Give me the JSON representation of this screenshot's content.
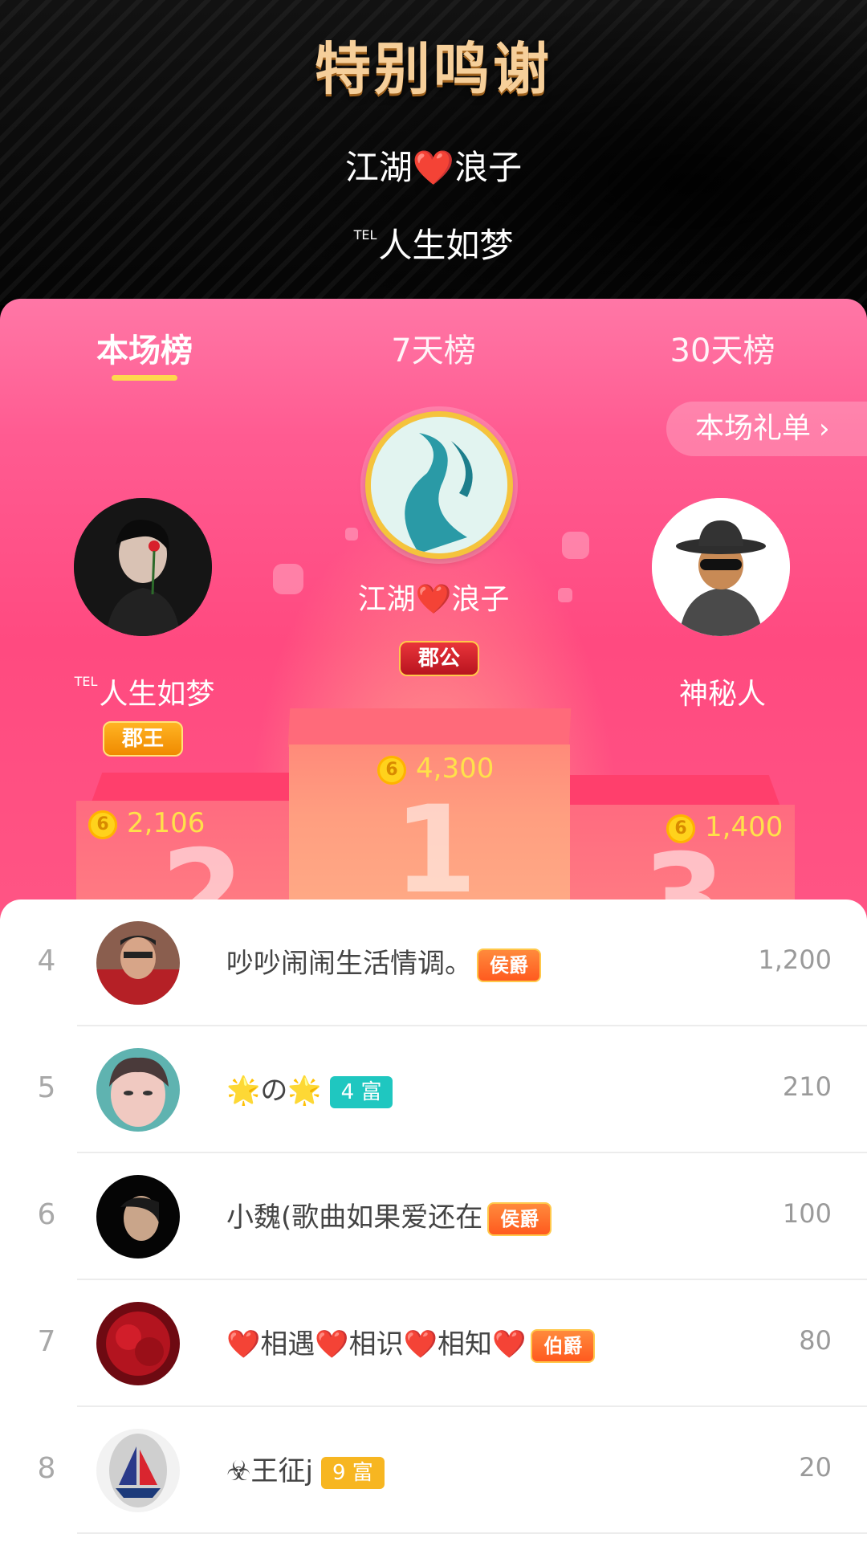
{
  "thanks": {
    "title": "特别鸣谢",
    "names": [
      {
        "prefix": "",
        "name": "江湖❤️浪子"
      },
      {
        "prefix": "TEL",
        "name": "人生如梦"
      }
    ]
  },
  "tabs": [
    {
      "label": "本场榜",
      "active": true
    },
    {
      "label": "7天榜",
      "active": false
    },
    {
      "label": "30天榜",
      "active": false
    }
  ],
  "gift_list_label": "本场礼单",
  "podium": {
    "first": {
      "rank": "1",
      "name": "江湖❤️浪子",
      "badge": "郡公",
      "score": "4,300"
    },
    "second": {
      "rank": "2",
      "prefix": "TEL",
      "name": "人生如梦",
      "badge": "郡王",
      "score": "2,106"
    },
    "third": {
      "rank": "3",
      "name": "神秘人",
      "score": "1,400"
    }
  },
  "coin_symbol": "6",
  "list": [
    {
      "rank": "4",
      "name": "吵吵闹闹生活情调。",
      "badge": "侯爵",
      "badge_type": "title",
      "score": "1,200"
    },
    {
      "rank": "5",
      "name": "🌟の🌟",
      "badge": "4 富",
      "badge_type": "rich",
      "badge_color": "#1fc7c0",
      "score": "210"
    },
    {
      "rank": "6",
      "name": "小魏(歌曲如果爱还在",
      "badge": "侯爵",
      "badge_type": "title",
      "score": "100"
    },
    {
      "rank": "7",
      "name": "❤️相遇❤️相识❤️相知❤️",
      "badge": "伯爵",
      "badge_type": "title",
      "score": "80"
    },
    {
      "rank": "8",
      "name": "☣王征j",
      "badge": "9 富",
      "badge_type": "rich",
      "badge_color": "#f7b621",
      "score": "20"
    }
  ],
  "colors": {
    "accent_pink": "#ff4a80",
    "tab_underline": "#ffd84d",
    "coin_gold": "#ffd21c",
    "score_yellow": "#ffe14a"
  }
}
